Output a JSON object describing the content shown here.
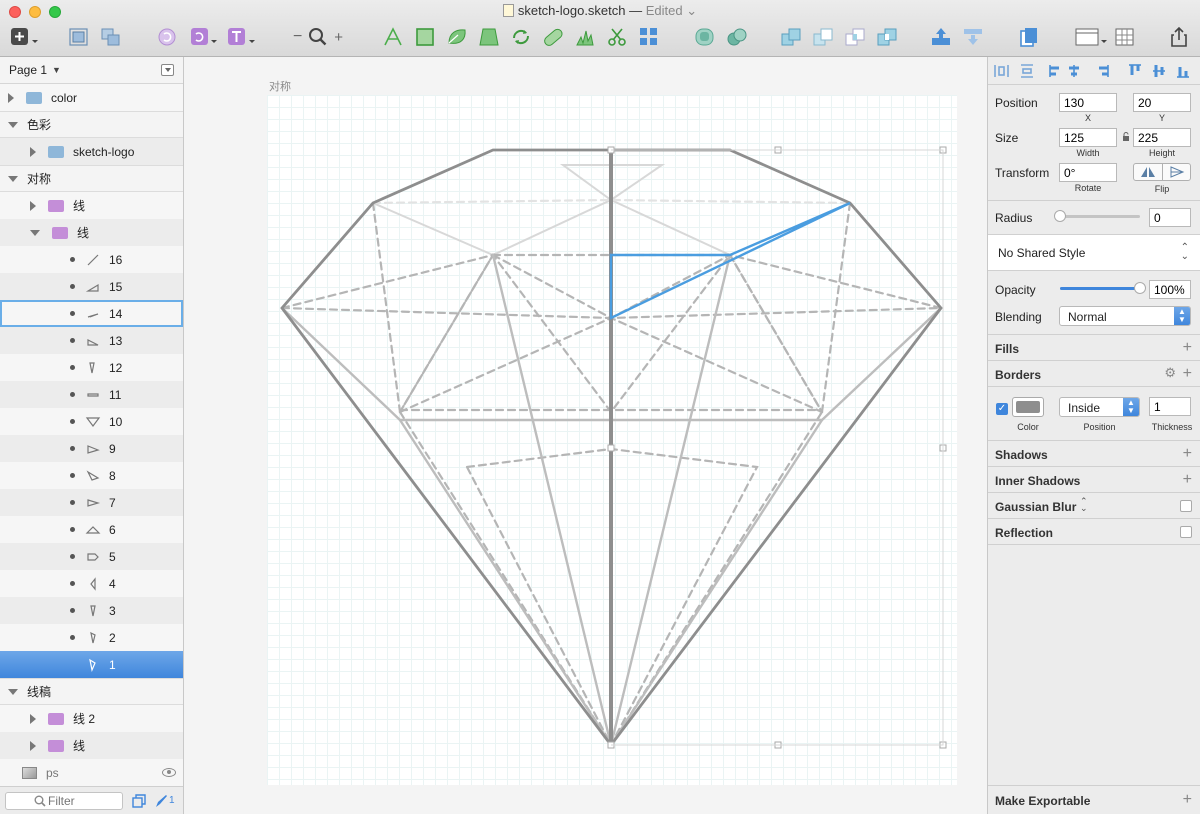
{
  "window": {
    "filename": "sketch-logo.sketch",
    "separator": "—",
    "status": "Edited"
  },
  "layers_panel": {
    "page_selector": "Page 1",
    "rows": [
      {
        "label": "color",
        "kind": "folder",
        "depth": 0,
        "expanded": false
      },
      {
        "label": "色彩",
        "kind": "artboard",
        "expanded": true
      },
      {
        "label": "sketch-logo",
        "kind": "folder",
        "depth": 1,
        "expanded": false
      },
      {
        "label": "对称",
        "kind": "artboard",
        "expanded": true
      },
      {
        "label": "线",
        "kind": "folder",
        "depth": 1,
        "expanded": false
      },
      {
        "label": "线",
        "kind": "folder",
        "depth": 1,
        "expanded": true
      },
      {
        "label": "16",
        "kind": "shape"
      },
      {
        "label": "15",
        "kind": "shape"
      },
      {
        "label": "14",
        "kind": "shape",
        "hover": true
      },
      {
        "label": "13",
        "kind": "shape"
      },
      {
        "label": "12",
        "kind": "shape"
      },
      {
        "label": "11",
        "kind": "shape"
      },
      {
        "label": "10",
        "kind": "shape"
      },
      {
        "label": "9",
        "kind": "shape"
      },
      {
        "label": "8",
        "kind": "shape"
      },
      {
        "label": "7",
        "kind": "shape"
      },
      {
        "label": "6",
        "kind": "shape"
      },
      {
        "label": "5",
        "kind": "shape"
      },
      {
        "label": "4",
        "kind": "shape"
      },
      {
        "label": "3",
        "kind": "shape"
      },
      {
        "label": "2",
        "kind": "shape"
      },
      {
        "label": "1",
        "kind": "shape",
        "selected": true
      },
      {
        "label": "线稿",
        "kind": "artboard",
        "expanded": true
      },
      {
        "label": "线 2",
        "kind": "folder",
        "depth": 1,
        "expanded": false
      },
      {
        "label": "线",
        "kind": "folder",
        "depth": 1,
        "expanded": false
      },
      {
        "label": "ps",
        "kind": "image"
      }
    ],
    "filter_placeholder": "Filter",
    "edit_count": "1"
  },
  "canvas": {
    "artboard_label": "对称"
  },
  "inspector": {
    "position": {
      "label": "Position",
      "x": "130",
      "y": "20",
      "x_label": "X",
      "y_label": "Y"
    },
    "size": {
      "label": "Size",
      "width": "125",
      "height": "225",
      "width_label": "Width",
      "height_label": "Height"
    },
    "transform": {
      "label": "Transform",
      "rotate": "0°",
      "rotate_label": "Rotate",
      "flip_label": "Flip"
    },
    "radius": {
      "label": "Radius",
      "value": "0",
      "slider_fraction": 0
    },
    "shared_style": "No Shared Style",
    "opacity": {
      "label": "Opacity",
      "value": "100%",
      "fraction": 1.0
    },
    "blending": {
      "label": "Blending",
      "value": "Normal"
    },
    "sections": {
      "fills": "Fills",
      "borders": "Borders",
      "shadows": "Shadows",
      "inner_shadows": "Inner Shadows",
      "gaussian_blur": "Gaussian Blur",
      "reflection": "Reflection"
    },
    "border": {
      "enabled": true,
      "color": "#8e8e8e",
      "position": "Inside",
      "thickness": "1",
      "color_label": "Color",
      "position_label": "Position",
      "thickness_label": "Thickness"
    },
    "make_exportable": "Make Exportable"
  },
  "colors": {
    "selection_blue": "#4a9de0",
    "accent": "#3f86dc",
    "folder_blue": "#8fb7d9",
    "folder_purple": "#c48ed8"
  }
}
